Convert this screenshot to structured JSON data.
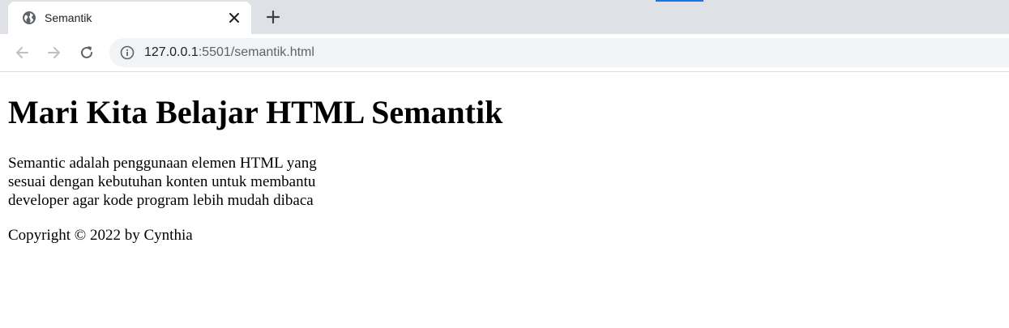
{
  "browser": {
    "tab": {
      "title": "Semantik",
      "icon": "globe-icon",
      "close_icon": "close-icon"
    },
    "new_tab_icon": "plus-icon",
    "nav": {
      "back_icon": "arrow-left-icon",
      "forward_icon": "arrow-right-icon",
      "reload_icon": "reload-icon"
    },
    "address": {
      "info_icon": "info-icon",
      "host": "127.0.0.1",
      "rest": ":5501/semantik.html"
    },
    "colors": {
      "tabstrip": "#dee1e6",
      "omnibox": "#f1f3f4",
      "accent": "#1a73e8"
    }
  },
  "page": {
    "heading": "Mari Kita Belajar HTML Semantik",
    "description": "Semantic adalah penggunaan elemen HTML yang sesuai dengan kebutuhan konten untuk membantu developer agar kode program lebih mudah dibaca",
    "footer": "Copyright © 2022 by Cynthia"
  }
}
